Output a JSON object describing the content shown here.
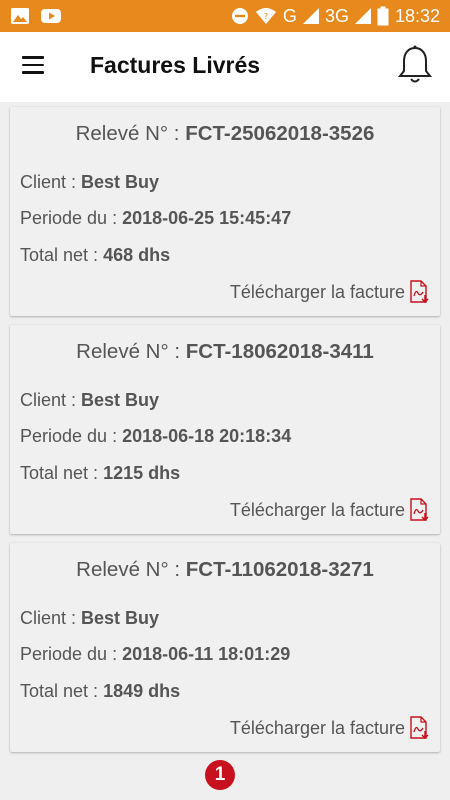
{
  "status_bar": {
    "network_g": "G",
    "network_3g": "3G",
    "time": "18:32",
    "icons": [
      "image-icon",
      "youtube-icon",
      "dnd-icon",
      "wifi-icon",
      "signal-icon",
      "battery-icon"
    ]
  },
  "app_bar": {
    "title": "Factures Livrés",
    "menu_icon": "hamburger-menu-icon",
    "notification_icon": "bell-icon"
  },
  "colors": {
    "status_bar": "#e8891d",
    "accent_red": "#c7111e",
    "text": "#555555"
  },
  "invoices": [
    {
      "title_prefix": "Relevé N° : ",
      "number": "FCT-25062018-3526",
      "client_label": "Client : ",
      "client": "Best Buy",
      "period_label": "Periode du : ",
      "period": "2018-06-25 15:45:47",
      "total_label": "Total net : ",
      "total": "468 dhs",
      "download_label": "Télécharger la facture"
    },
    {
      "title_prefix": "Relevé N° : ",
      "number": "FCT-18062018-3411",
      "client_label": "Client : ",
      "client": "Best Buy",
      "period_label": "Periode du : ",
      "period": "2018-06-18 20:18:34",
      "total_label": "Total net : ",
      "total": "1215 dhs",
      "download_label": "Télécharger la facture"
    },
    {
      "title_prefix": "Relevé N° : ",
      "number": "FCT-11062018-3271",
      "client_label": "Client : ",
      "client": "Best Buy",
      "period_label": "Periode du : ",
      "period": "2018-06-11 18:01:29",
      "total_label": "Total net : ",
      "total": "1849 dhs",
      "download_label": "Télécharger la facture"
    }
  ],
  "pagination": {
    "current_page": "1"
  }
}
